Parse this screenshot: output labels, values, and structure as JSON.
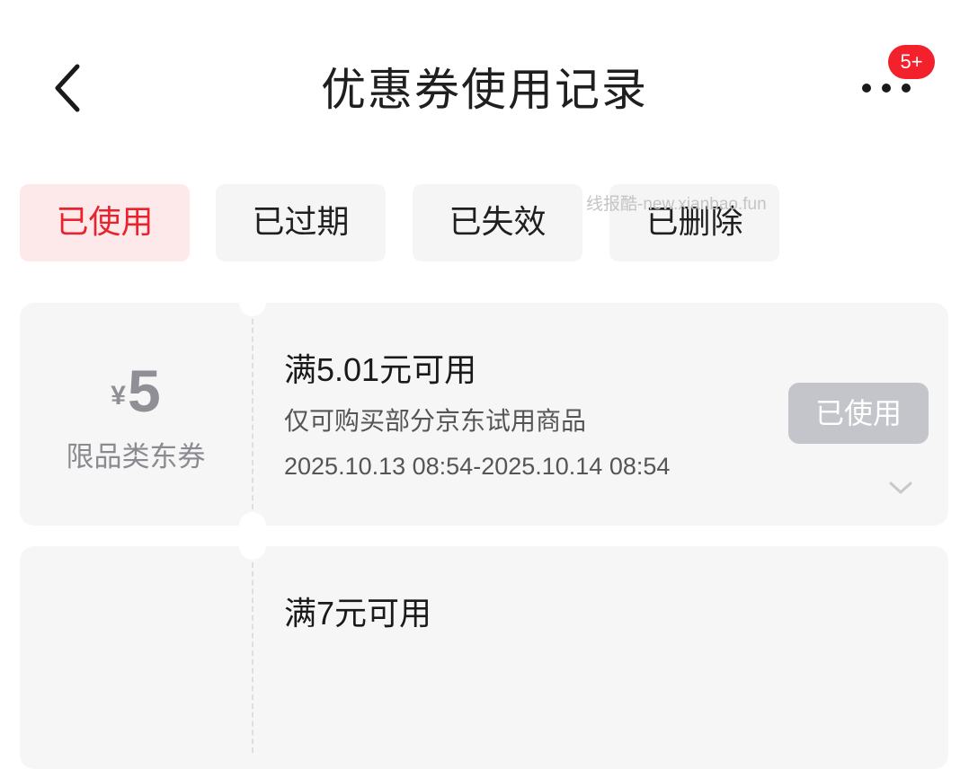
{
  "header": {
    "title": "优惠券使用记录",
    "back_icon": "back-arrow-icon",
    "more_icon": "more-dots-icon",
    "badge": "5+"
  },
  "tabs": [
    {
      "label": "已使用",
      "active": true
    },
    {
      "label": "已过期",
      "active": false
    },
    {
      "label": "已失效",
      "active": false
    },
    {
      "label": "已删除",
      "active": false
    }
  ],
  "watermark": "线报酷-new.xianbao.fun",
  "coupons": [
    {
      "currency": "¥",
      "amount": "5",
      "type": "限品类东券",
      "condition": "满5.01元可用",
      "description": "仅可购买部分京东试用商品",
      "validity": "2025.10.13 08:54-2025.10.14 08:54",
      "status": "已使用"
    },
    {
      "condition": "满7元可用"
    }
  ],
  "colors": {
    "accent": "#e8232d",
    "badge": "#f2212b",
    "card_bg": "#f6f6f6",
    "tab_bg": "#f5f5f5",
    "tab_active_bg": "#fde8ea",
    "used_button": "#c3c5cb"
  }
}
